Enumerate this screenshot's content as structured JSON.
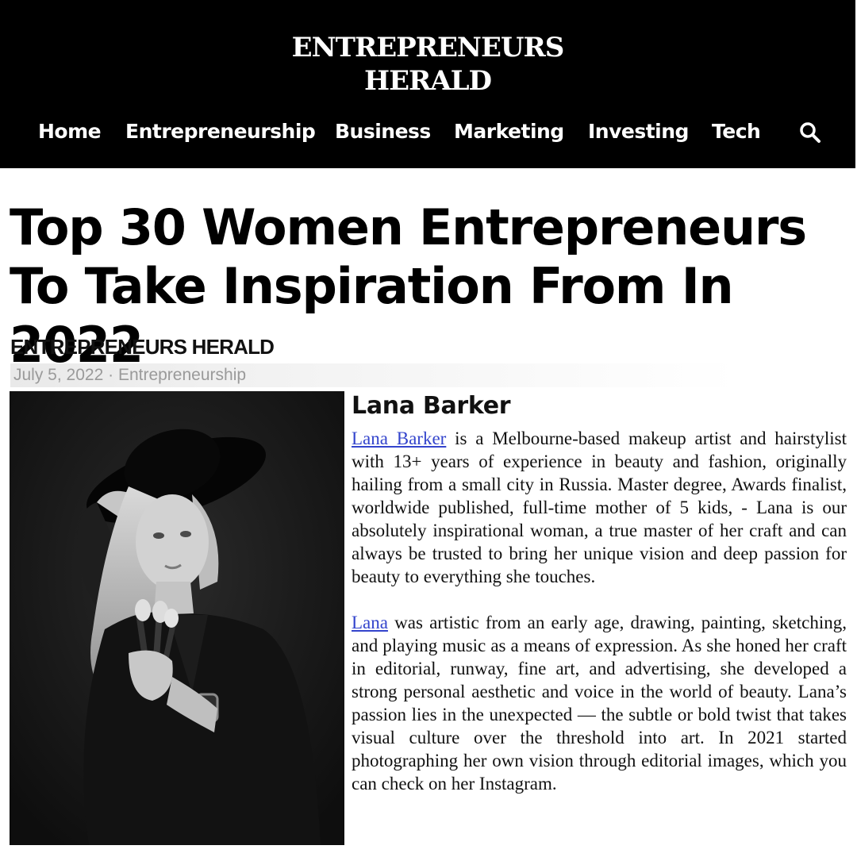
{
  "header": {
    "logo_line1": "ENTREPRENEURS",
    "logo_line2": "HERALD",
    "nav": [
      {
        "label": "Home"
      },
      {
        "label": "Entrepreneurship"
      },
      {
        "label": "Business"
      },
      {
        "label": "Marketing"
      },
      {
        "label": "Investing"
      },
      {
        "label": "Tech"
      }
    ],
    "search_icon": "search-icon"
  },
  "article": {
    "title": "Top 30 Women Entrepreneurs To Take Inspiration From In 2022",
    "author": "ENTREPRENEURS HERALD",
    "date": "July 5, 2022",
    "separator": "·",
    "category": "Entrepreneurship",
    "profile_name": "Lana Barker",
    "p1_link": "Lana Barker",
    "p1_text": " is a Melbourne-based makeup artist and hairstylist with 13+ years of experience in beauty and fashion, originally hailing from a small city in Russia. Master degree, Awards finalist, worldwide published, full-time mother of 5 kids, - Lana is our absolutely inspirational woman, a true master of her craft and can always be trusted to bring her unique vision and deep passion for beauty to everything she touches.",
    "p2_link": "Lana",
    "p2_text": " was artistic from an early age, drawing, painting, sketching, and playing music as a means of expression. As she honed her craft in editorial, runway, fine art, and advertising, she developed a strong personal aesthetic and voice in the world of beauty. Lana’s passion lies in the unexpected — the subtle or bold twist that takes visual culture over the threshold into art. In 2021 started photographing her own vision through editorial images, which you can check on her Instagram."
  },
  "colors": {
    "header_bg": "#000000",
    "link": "#3344cc",
    "meta_text": "#9a9a9a"
  }
}
